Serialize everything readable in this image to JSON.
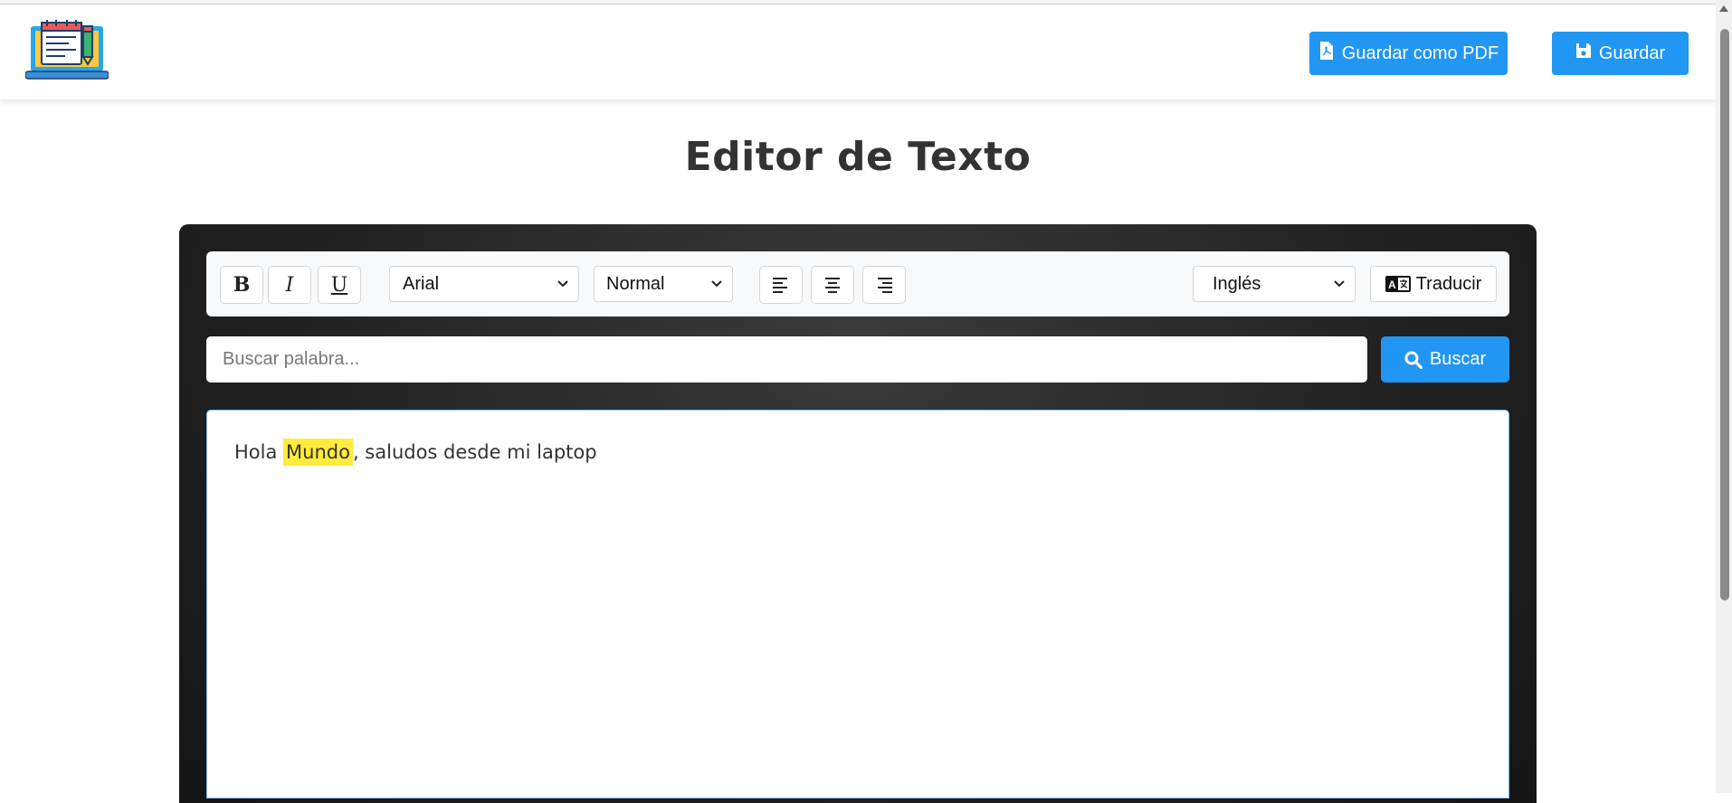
{
  "header": {
    "logo_icon": "laptop-document-icon",
    "save_pdf_label": "Guardar como PDF",
    "save_label": "Guardar"
  },
  "page_title": "Editor de Texto",
  "toolbar": {
    "bold_label": "B",
    "italic_label": "I",
    "underline_label": "U",
    "font_family": "Arial",
    "font_size": "Normal",
    "language": "Inglés",
    "translate_label": "Traducir"
  },
  "search": {
    "placeholder": "Buscar palabra...",
    "value": "",
    "button_label": "Buscar"
  },
  "editor": {
    "text_before": "Hola ",
    "highlighted": "Mundo",
    "text_after": ", saludos desde mi laptop"
  },
  "colors": {
    "primary": "#2196f3",
    "highlight": "#ffeb3b",
    "panel": "#222222"
  }
}
